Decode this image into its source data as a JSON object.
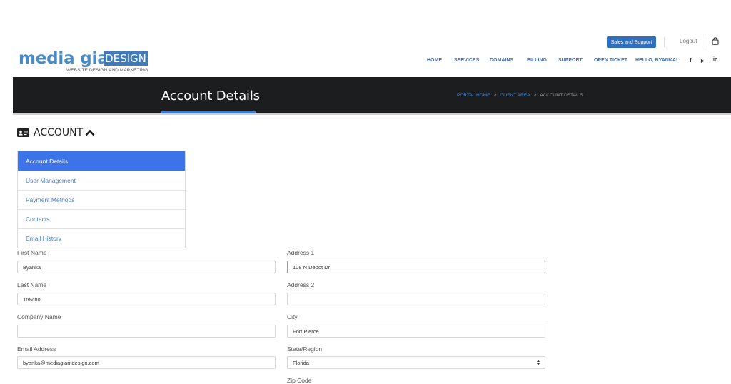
{
  "header": {
    "sales_support_label": "Sales and Support",
    "logout_label": "Logout",
    "cart_icon": "cart-icon"
  },
  "logo": {
    "media_text": "media giant",
    "design_text": "DESIGN",
    "tagline": "WEBSITE DESIGN AND MARKETING"
  },
  "nav": {
    "items": [
      {
        "label": "HOME"
      },
      {
        "label": "SERVICES"
      },
      {
        "label": "DOMAINS"
      },
      {
        "label": "BILLING"
      },
      {
        "label": "SUPPORT"
      },
      {
        "label": "OPEN TICKET"
      },
      {
        "label": "HELLO, BYANKA!"
      }
    ],
    "social": [
      {
        "icon": "facebook-icon",
        "glyph": "f"
      },
      {
        "icon": "youtube-icon",
        "glyph": "▶"
      },
      {
        "icon": "linkedin-icon",
        "glyph": "in"
      }
    ]
  },
  "banner": {
    "title": "Account Details",
    "breadcrumb": [
      {
        "label": "PORTAL HOME"
      },
      {
        "label": "CLIENT AREA"
      },
      {
        "label": "ACCOUNT DETAILS"
      }
    ],
    "separator": ">"
  },
  "account": {
    "heading": "ACCOUNT",
    "menu": [
      {
        "label": "Account Details",
        "active": true
      },
      {
        "label": "User Management",
        "active": false
      },
      {
        "label": "Payment Methods",
        "active": false
      },
      {
        "label": "Contacts",
        "active": false
      },
      {
        "label": "Email History",
        "active": false
      }
    ]
  },
  "form": {
    "first_name": {
      "label": "First Name",
      "value": "Byanka"
    },
    "last_name": {
      "label": "Last Name",
      "value": "Trevino"
    },
    "company_name": {
      "label": "Company Name",
      "value": ""
    },
    "email": {
      "label": "Email Address",
      "value": "byanka@mediagiantdesign.com"
    },
    "address1": {
      "label": "Address 1",
      "value": "108 N Depot Dr"
    },
    "address2": {
      "label": "Address 2",
      "value": ""
    },
    "city": {
      "label": "City",
      "value": "Fort Pierce"
    },
    "state": {
      "label": "State/Region",
      "value": "Florida"
    },
    "zip": {
      "label": "Zip Code"
    }
  },
  "colors": {
    "brand_blue": "#2f6fc0",
    "banner_dark": "#1c1d1f",
    "active_blue": "#3d73e8"
  }
}
